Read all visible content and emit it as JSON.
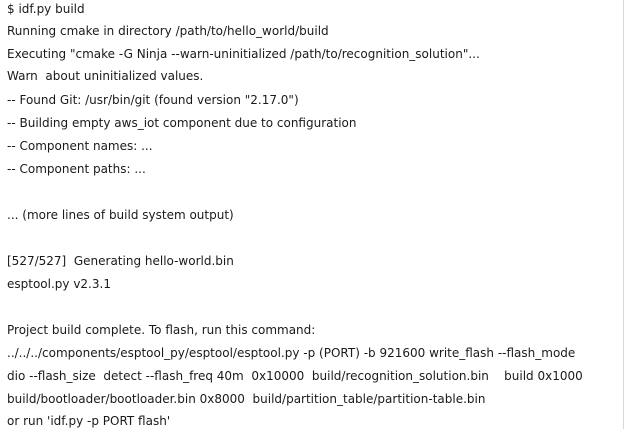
{
  "terminal": {
    "lines": [
      "$ idf.py build",
      "Running cmake in directory /path/to/hello_world/build",
      "Executing \"cmake -G Ninja --warn-uninitialized /path/to/recognition_solution\"...",
      "Warn  about uninitialized values.",
      "-- Found Git: /usr/bin/git (found version \"2.17.0\")",
      "-- Building empty aws_iot component due to configuration",
      "-- Component names: ...",
      "-- Component paths: ...",
      "... (more lines of build system output)",
      "[527/527]  Generating hello-world.bin",
      "esptool.py v2.3.1",
      "Project build complete. To flash, run this command:",
      "../../../components/esptool_py/esptool/esptool.py -p (PORT) -b 921600 write_flash --flash_mode",
      "dio --flash_size  detect --flash_freq 40m  0x10000  build/recognition_solution.bin    build 0x1000",
      "build/bootloader/bootloader.bin 0x8000  build/partition_table/partition-table.bin",
      "or run 'idf.py -p PORT flash'"
    ]
  }
}
